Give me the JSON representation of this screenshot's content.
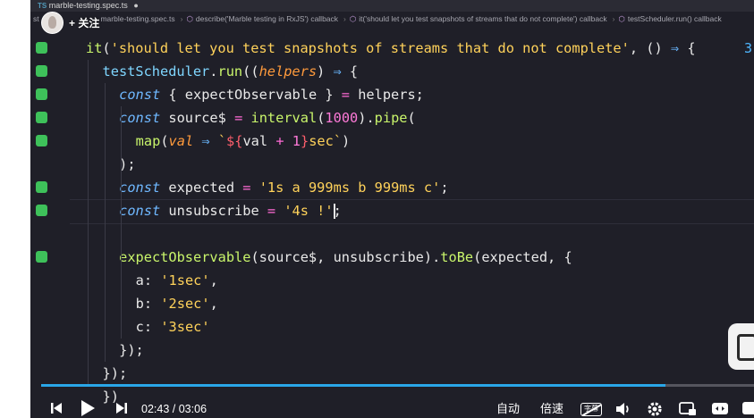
{
  "tab": {
    "lang_badge": "TS",
    "file_name": "marble-testing.spec.ts",
    "dirty_marker": "●"
  },
  "breadcrumb": {
    "items": [
      "st",
      "marble-testing.spec.ts",
      "describe('Marble testing in RxJS') callback",
      "it('should let you test snapshots of streams that do not complete') callback",
      "testScheduler.run() callback"
    ]
  },
  "follow": {
    "label": "+ 关注"
  },
  "editor": {
    "right_edge_number": "3",
    "current_line_index": 7
  },
  "player": {
    "time_current": "02:43",
    "time_separator": "/",
    "time_total": "03:06",
    "progress": 0.876,
    "auto_label": "自动",
    "speed_label": "倍速",
    "subtitle_label": "字幕",
    "accent": "#2aa6e8"
  },
  "colors": {
    "gutter_marker": "#3ec15a",
    "background": "#1f1f28"
  }
}
